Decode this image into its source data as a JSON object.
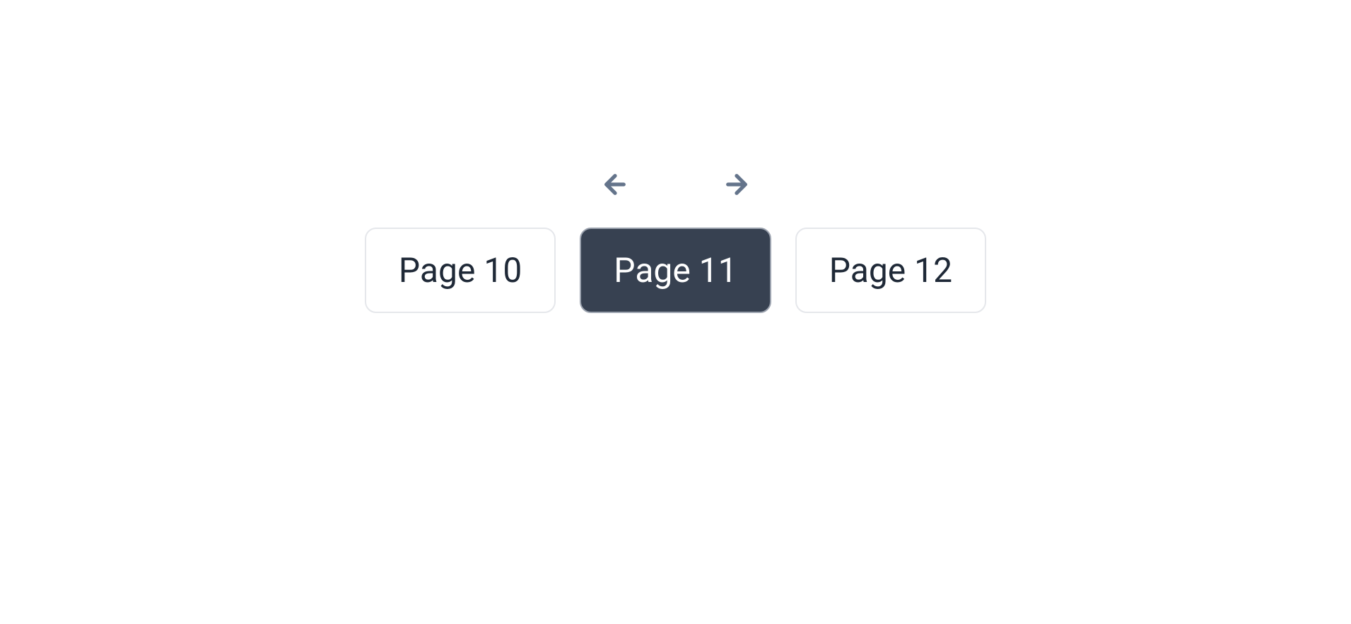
{
  "pagination": {
    "pages": [
      {
        "label": "Page 10",
        "active": false
      },
      {
        "label": "Page 11",
        "active": true
      },
      {
        "label": "Page 12",
        "active": false
      }
    ]
  }
}
